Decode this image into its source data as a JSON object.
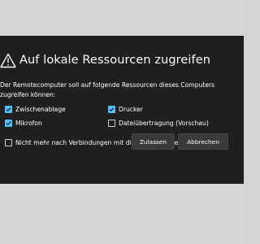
{
  "dialog": {
    "title": "Auf lokale Ressourcen zugreifen",
    "title_icon": "warning-triangle-icon",
    "description": "Der Remotecomputer soll auf folgende Ressourcen dieses Computers zugreifen können:",
    "resources": [
      {
        "label": "Zwischenablage",
        "checked": true
      },
      {
        "label": "Drucker",
        "checked": true
      },
      {
        "label": "Mikrofon",
        "checked": true
      },
      {
        "label": "Dateiübertragung (Vorschau)",
        "checked": false
      }
    ],
    "dont_ask_label": "Nicht mehr nach Verbindungen mit diesem Computer fragen",
    "dont_ask_checked": false,
    "allow_button": "Zulassen",
    "cancel_button": "Abbrechen"
  },
  "colors": {
    "dialog_background": "#1f1f1f",
    "backdrop": "#d6d6d6",
    "checkbox_accent": "#4cc2ff",
    "button_background": "#3a3a3a"
  }
}
